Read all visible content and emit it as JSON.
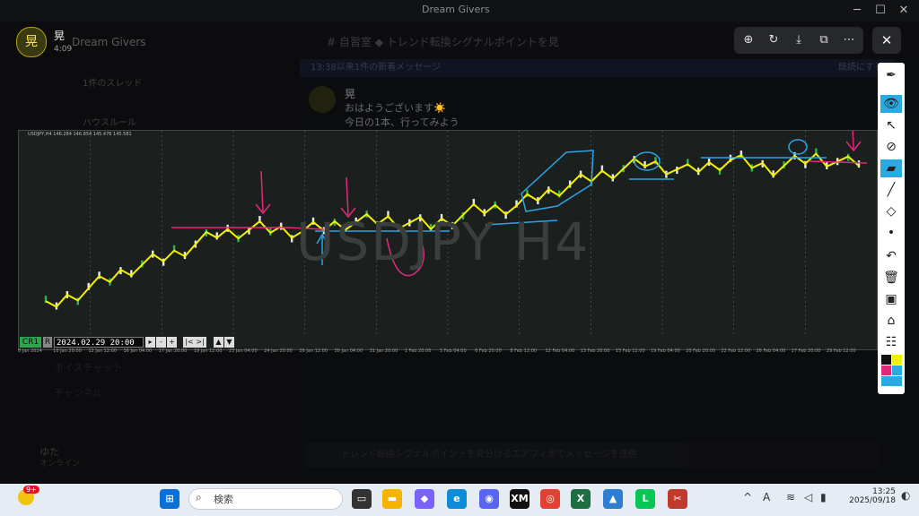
{
  "window": {
    "title": "Dream Givers",
    "controls": [
      "─",
      "☐",
      "✕"
    ]
  },
  "sidebar": {
    "server_name": "Dream Givers",
    "user_name": "晃",
    "time": "4:09",
    "avatar_char": "晃",
    "items": [
      "1件のスレッド",
      "ハウスルール"
    ],
    "lower_items": [
      "ボイスチャット",
      "チャンネル"
    ],
    "footer_user": "ゆた",
    "footer_status": "オンライン"
  },
  "channel_header": {
    "name": "自習室",
    "thread": "トレンド転換シグナルポイントを見",
    "hash": "#"
  },
  "notice": {
    "text": "13:38以来1件の新着メッセージ",
    "action": "既読にする"
  },
  "message": {
    "author": "晃",
    "time": "4:09",
    "lines": [
      "おはようございます☀️",
      "今日の1本、行ってみよう"
    ]
  },
  "input_placeholder": "トレンド転換シグナルポイントを見分けるエアフィボでメッセージを送信",
  "viewer_toolbar": {
    "zoom": "⊕",
    "rotate": "↻",
    "download": "⤓",
    "open": "⧉",
    "more": "⋯",
    "close": "✕"
  },
  "chart": {
    "symbol_info": "USDJPY,H4 146.284 146.854 145.476 145.581",
    "watermark": "USDJPY H4",
    "cr_label": "CR1",
    "r_label": "R",
    "nav_date": "2024.02.29 20:00",
    "date_labels": [
      "8 Jan 2024",
      "10 Jan 20:00",
      "12 Jan 12:00",
      "16 Jan 04:00",
      "17 Jan 20:00",
      "19 Jan 12:00",
      "23 Jan 04:00",
      "24 Jan 20:00",
      "26 Jan 12:00",
      "30 Jan 04:00",
      "31 Jan 20:00",
      "1 Feb 20:00",
      "5 Feb 04:00",
      "6 Feb 20:00",
      "8 Feb 12:00",
      "12 Feb 04:00",
      "13 Feb 20:00",
      "15 Feb 12:00",
      "19 Feb 04:00",
      "20 Feb 20:00",
      "22 Feb 12:00",
      "26 Feb 04:00",
      "27 Feb 20:00",
      "29 Feb 12:00"
    ]
  },
  "chart_data": {
    "type": "line",
    "series": [
      {
        "name": "",
        "values": [
          145.2,
          145.9,
          146.6,
          147.1,
          147.8,
          148.0,
          147.9,
          148.2,
          148.3,
          148.1,
          148.6,
          148.8,
          149.4,
          149.9,
          150.3,
          150.0,
          150.4,
          150.1,
          150.5,
          150.2
        ]
      }
    ]
  },
  "pen_toolbar": [
    "pen-icon",
    "eye-icon",
    "cursor-icon",
    "laser-icon",
    "highlighter-icon",
    "pencil-icon",
    "eraser-icon",
    "dot-icon",
    "undo-icon",
    "trash-icon",
    "screenshot-icon",
    "camera-icon",
    "clipboard-icon"
  ],
  "colors": {
    "accent": "#29abe2",
    "pen_yellow": "#f2f200",
    "pen_pink": "#e4287c",
    "pen_blue": "#2aa6e6",
    "candle_up": "#e8e8e8",
    "candle_down": "#2db34a"
  },
  "taskbar": {
    "search_placeholder": "検索",
    "time": "13:25",
    "date": "2025/09/18",
    "badge": "9+",
    "ime": "A"
  }
}
